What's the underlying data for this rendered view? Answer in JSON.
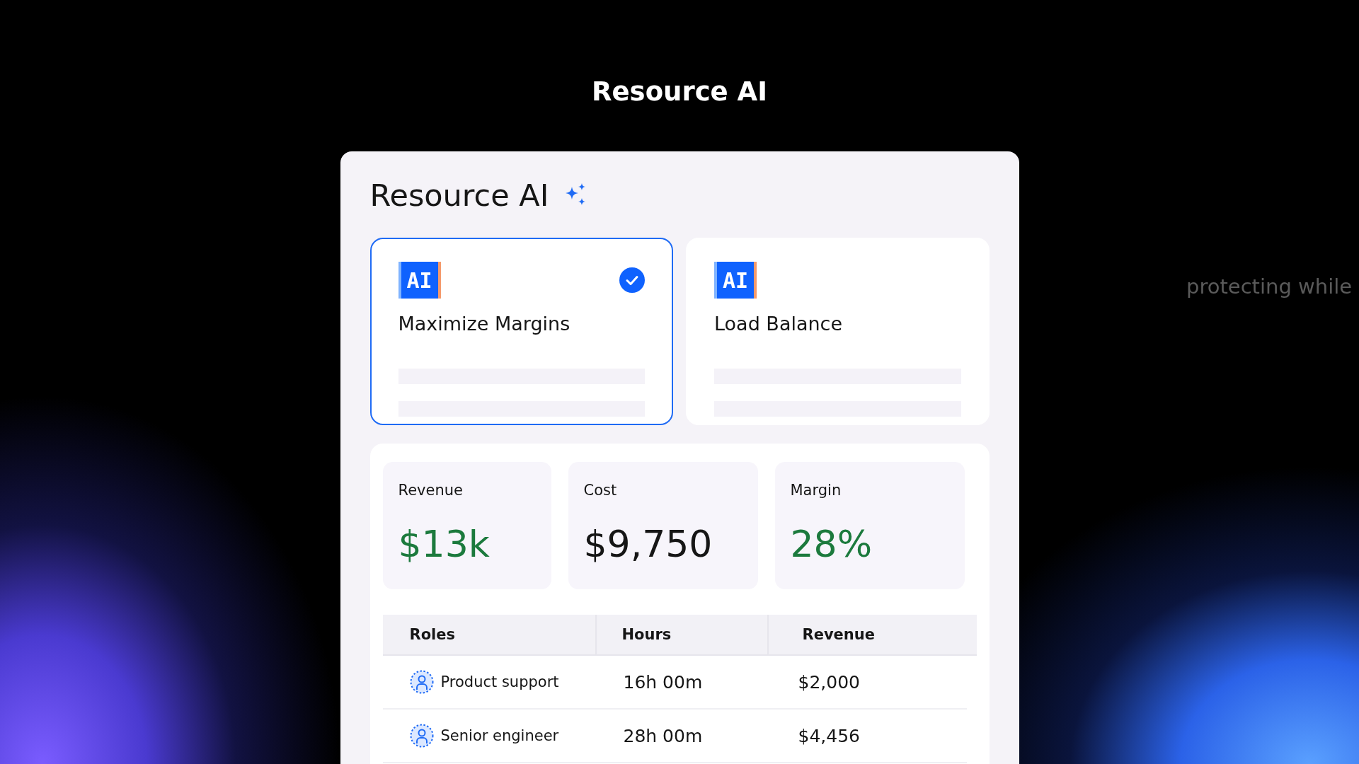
{
  "page_title": "Resource AI",
  "faint_text": "protecting while",
  "panel": {
    "title": "Resource AI",
    "options": [
      {
        "badge": "AI",
        "label": "Maximize Margins",
        "selected": true
      },
      {
        "badge": "AI",
        "label": "Load Balance",
        "selected": false
      }
    ],
    "metrics": [
      {
        "label": "Revenue",
        "value": "$13k",
        "positive": true
      },
      {
        "label": "Cost",
        "value": "$9,750",
        "positive": false
      },
      {
        "label": "Margin",
        "value": "28%",
        "positive": true
      }
    ],
    "table": {
      "columns": [
        "Roles",
        "Hours",
        "Revenue"
      ],
      "rows": [
        {
          "role": "Product support",
          "hours": "16h 00m",
          "revenue": "$2,000"
        },
        {
          "role": "Senior engineer",
          "hours": "28h 00m",
          "revenue": "$4,456"
        }
      ]
    }
  }
}
